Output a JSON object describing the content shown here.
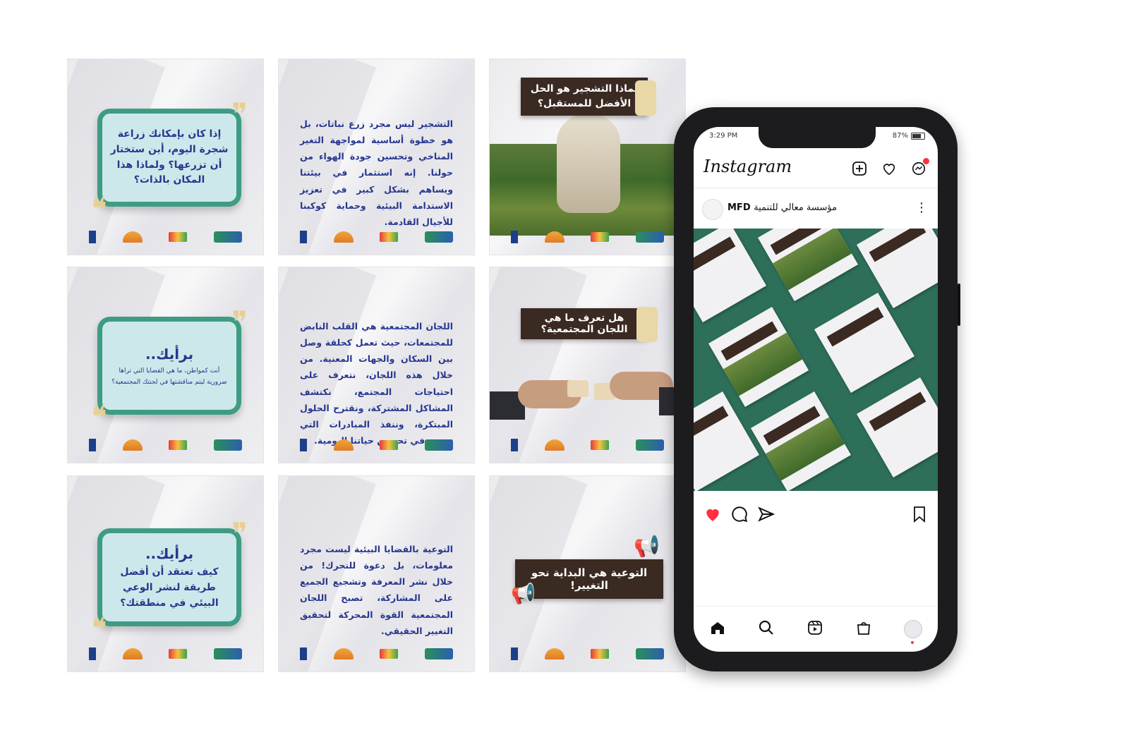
{
  "tiles": {
    "t1": {
      "text": "إذا كان بإمكانك زراعة شجرة اليوم، أين ستختار أن تزرعها؟ ولماذا هذا المكان بالذات؟"
    },
    "t2": {
      "text": "التشجير ليس مجرد زرع نباتات، بل هو خطوة أساسية لمواجهة التغير المناخي وتحسين جودة الهواء من حولنا. إنه استثمار في بيئتنا ويساهم بشكل كبير في تعزيز الاستدامة البيئية وحماية كوكبنا للأجيال القادمة."
    },
    "t3": {
      "text": "لماذا التشجير هو الحل الأفضل للمستقبل؟"
    },
    "t4": {
      "head": "برأيك..",
      "text": "أنت كمواطن، ما هي القضايا التي تراها ضرورية ليتم مناقشتها في لجنتك المجتمعية؟"
    },
    "t5": {
      "text": "اللجان المجتمعية هي القلب النابض للمجتمعات، حيث تعمل كحلقة وصل بين السكان والجهات المعنية. من خلال هذه اللجان، نتعرف على احتياجات المجتمع، نكتشف المشاكل المشتركة، ونقترح الحلول المبتكرة، وننفذ المبادرات التي تسهم في تحسين حياتنا اليومية."
    },
    "t6": {
      "text": "هل تعرف ما هي اللجان المجتمعية؟"
    },
    "t7": {
      "head": "برأيك..",
      "text": "كيف تعتقد أن أفضل طريقة لنشر الوعي البيئي في منطقتك؟"
    },
    "t8": {
      "text": "التوعية بالقضايا البيئية ليست مجرد معلومات، بل دعوة للتحرك! من خلال نشر المعرفة وتشجيع الجميع على المشاركة، تصبح اللجان المجتمعية القوة المحركة لتحقيق التغيير الحقيقي."
    },
    "t9": {
      "text": "التوعية هي البداية نحو التغيير!"
    }
  },
  "phone": {
    "status": {
      "time": "3:29 PM",
      "battery": "87%"
    },
    "app": {
      "logo": "Instagram"
    },
    "post": {
      "handle": "MFD",
      "account_name": "مؤسسة معالي للتنمية"
    },
    "icons": {
      "new_post": "plus-square-icon",
      "activity": "heart-icon",
      "messenger": "messenger-icon",
      "more": "more-vertical-icon",
      "like": "heart-filled-icon",
      "comment": "comment-icon",
      "share": "send-icon",
      "save": "bookmark-icon",
      "home": "home-icon",
      "search": "search-icon",
      "reels": "reels-icon",
      "shop": "shop-icon",
      "profile": "profile-avatar"
    },
    "colors": {
      "like": "#ff3040",
      "notification": "#ff3040"
    }
  },
  "colors": {
    "brand_text": "#27378f",
    "bubble_border": "#3f9c84",
    "bubble_fill": "#cde8ea",
    "paper": "#3a2a22"
  }
}
